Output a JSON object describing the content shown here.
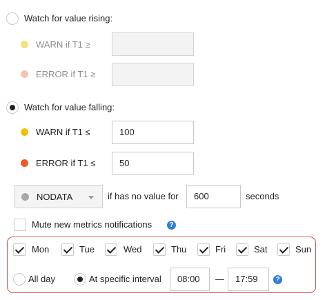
{
  "rising": {
    "label": "Watch for value rising:",
    "checked": false,
    "warn": {
      "label": "WARN if T1 ≥",
      "value": "",
      "color": "#f7df7a"
    },
    "error": {
      "label": "ERROR if T1 ≥",
      "value": "",
      "color": "#f8c2b3"
    }
  },
  "falling": {
    "label": "Watch for value falling:",
    "checked": true,
    "warn": {
      "label": "WARN if T1 ≤",
      "value": "100",
      "color": "#f3bf0b"
    },
    "error": {
      "label": "ERROR if T1 ≤",
      "value": "50",
      "color": "#ef5a27"
    }
  },
  "nodata": {
    "state": "NODATA",
    "state_color": "#a8a8a8",
    "prefix": "if has no value for",
    "value": "600",
    "suffix": "seconds"
  },
  "mute": {
    "label": "Mute new metrics notifications",
    "checked": false,
    "help": "?"
  },
  "schedule": {
    "days": [
      {
        "label": "Mon",
        "checked": true
      },
      {
        "label": "Tue",
        "checked": true
      },
      {
        "label": "Wed",
        "checked": true
      },
      {
        "label": "Thu",
        "checked": true
      },
      {
        "label": "Fri",
        "checked": true
      },
      {
        "label": "Sat",
        "checked": true
      },
      {
        "label": "Sun",
        "checked": true
      }
    ],
    "all_day": {
      "label": "All day",
      "checked": false
    },
    "interval": {
      "label": "At specific interval",
      "checked": true
    },
    "from": "08:00",
    "separator": "—",
    "to": "17:59",
    "help": "?",
    "border_color": "#d94c4c"
  }
}
